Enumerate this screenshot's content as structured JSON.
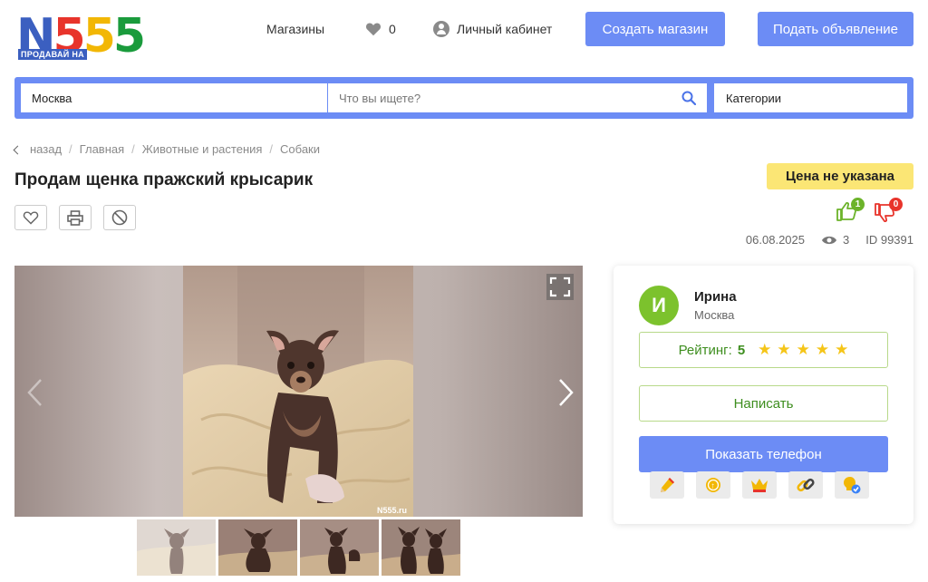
{
  "header": {
    "logo_text": "N555",
    "logo_tagline": "ПРОДАВАЙ НА",
    "nav_shops": "Магазины",
    "favorites_count": "0",
    "nav_cabinet": "Личный кабинет",
    "btn_create_shop": "Создать магазин",
    "btn_post_ad": "Подать объявление"
  },
  "search": {
    "city": "Москва",
    "placeholder": "Что вы ищете?",
    "categories": "Категории"
  },
  "breadcrumb": {
    "back": "назад",
    "items": [
      "Главная",
      "Животные и растения",
      "Собаки"
    ]
  },
  "listing": {
    "title": "Продам щенка пражский крысарик",
    "price": "Цена не указана",
    "likes": "1",
    "dislikes": "0",
    "date": "06.08.2025",
    "views": "3",
    "id": "ID 99391",
    "watermark": "N555.ru"
  },
  "seller": {
    "initial": "И",
    "name": "Ирина",
    "city": "Москва",
    "rating_label": "Рейтинг:",
    "rating_value": "5",
    "btn_write": "Написать",
    "btn_phone": "Показать телефон"
  },
  "colors": {
    "accent": "#6c8cf5",
    "price_bg": "#fbe675",
    "like": "#7cc22d",
    "dislike": "#e8342b",
    "avatar": "#7cc22d"
  },
  "icons": {
    "favorite": "heart-icon",
    "print": "printer-icon",
    "report": "block-icon",
    "promos": [
      "pencil-icon",
      "coin-icon",
      "crown-icon",
      "link-icon",
      "bulb-check-icon"
    ]
  }
}
